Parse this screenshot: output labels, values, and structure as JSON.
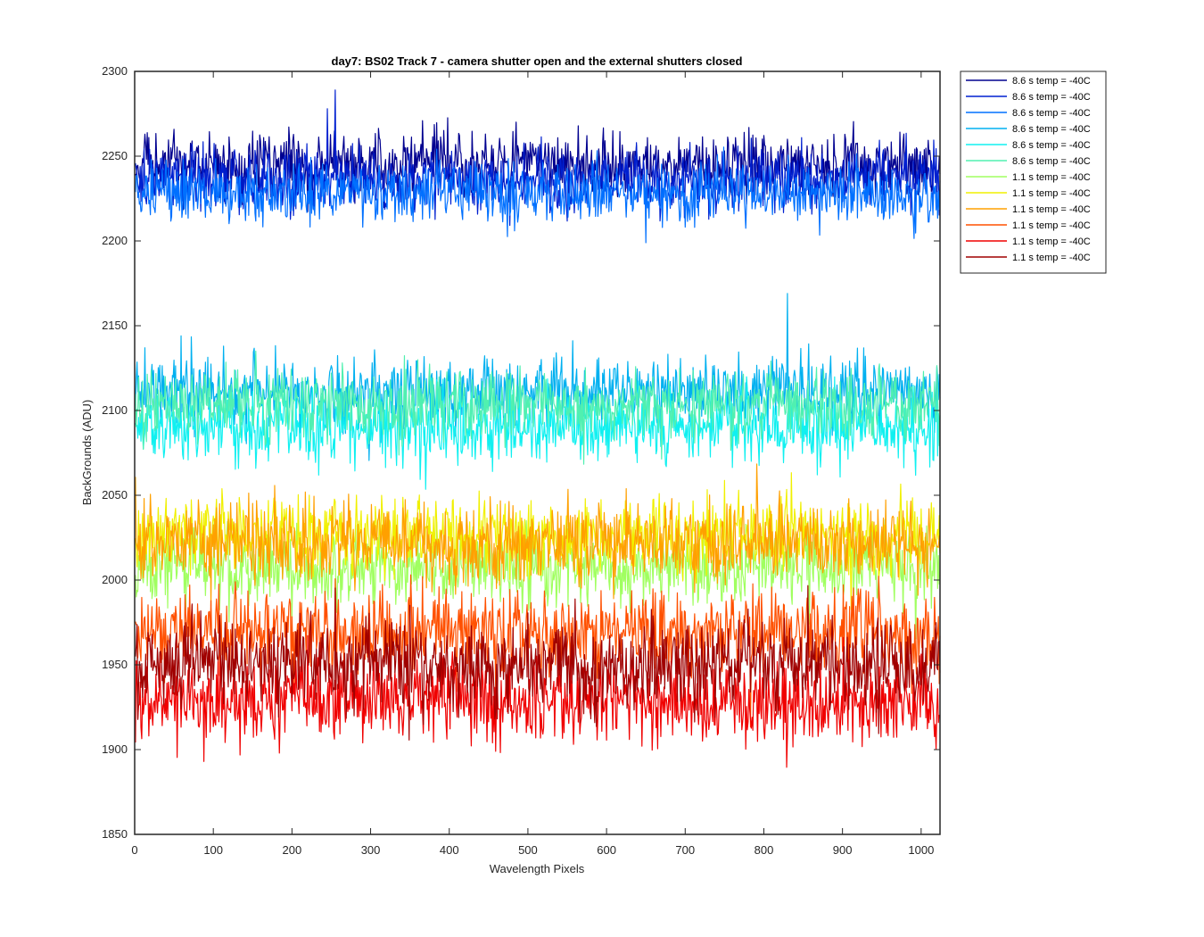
{
  "chart_data": {
    "type": "line",
    "title": "day7: BS02  Track 7 - camera shutter open and the external shutters closed",
    "xlabel": "Wavelength Pixels",
    "ylabel": "BackGrounds (ADU)",
    "xlim": [
      0,
      1024
    ],
    "ylim": [
      1850,
      2300
    ],
    "xticks": [
      0,
      100,
      200,
      300,
      400,
      500,
      600,
      700,
      800,
      900,
      1000
    ],
    "yticks": [
      1850,
      1900,
      1950,
      2000,
      2050,
      2100,
      2150,
      2200,
      2250,
      2300
    ],
    "grid": false,
    "legend_position": "outside-top-right",
    "x": {
      "start": 1,
      "end": 1024,
      "step": 1
    },
    "series": [
      {
        "name": "8.6 s temp = -40C",
        "color": "#00008F",
        "mean": 2245,
        "noise": 9,
        "peaks": []
      },
      {
        "name": "8.6 s temp = -40C",
        "color": "#0020D0",
        "mean": 2236,
        "noise": 9,
        "peaks": [
          {
            "x": 255,
            "y": 2289
          },
          {
            "x": 245,
            "y": 2278
          }
        ]
      },
      {
        "name": "8.6 s temp = -40C",
        "color": "#0070FF",
        "mean": 2228,
        "noise": 9,
        "peaks": []
      },
      {
        "name": "8.6 s temp = -40C",
        "color": "#00B0F0",
        "mean": 2112,
        "noise": 10,
        "peaks": [
          {
            "x": 830,
            "y": 2169
          }
        ]
      },
      {
        "name": "8.6 s temp = -40C",
        "color": "#10F0F0",
        "mean": 2090,
        "noise": 10,
        "peaks": []
      },
      {
        "name": "8.6 s temp = -40C",
        "color": "#50F0B0",
        "mean": 2104,
        "noise": 10,
        "peaks": []
      },
      {
        "name": "1.1 s temp = -40C",
        "color": "#A0FF60",
        "mean": 2007,
        "noise": 11,
        "peaks": []
      },
      {
        "name": "1.1 s temp = -40C",
        "color": "#F0F000",
        "mean": 2027,
        "noise": 11,
        "peaks": []
      },
      {
        "name": "1.1 s temp = -40C",
        "color": "#FFA000",
        "mean": 2022,
        "noise": 12,
        "peaks": []
      },
      {
        "name": "1.1 s temp = -40C",
        "color": "#FF5000",
        "mean": 1970,
        "noise": 12,
        "peaks": []
      },
      {
        "name": "1.1 s temp = -40C",
        "color": "#F00000",
        "mean": 1928,
        "noise": 12,
        "peaks": []
      },
      {
        "name": "1.1 s temp = -40C",
        "color": "#A00000",
        "mean": 1950,
        "noise": 13,
        "peaks": []
      }
    ]
  }
}
